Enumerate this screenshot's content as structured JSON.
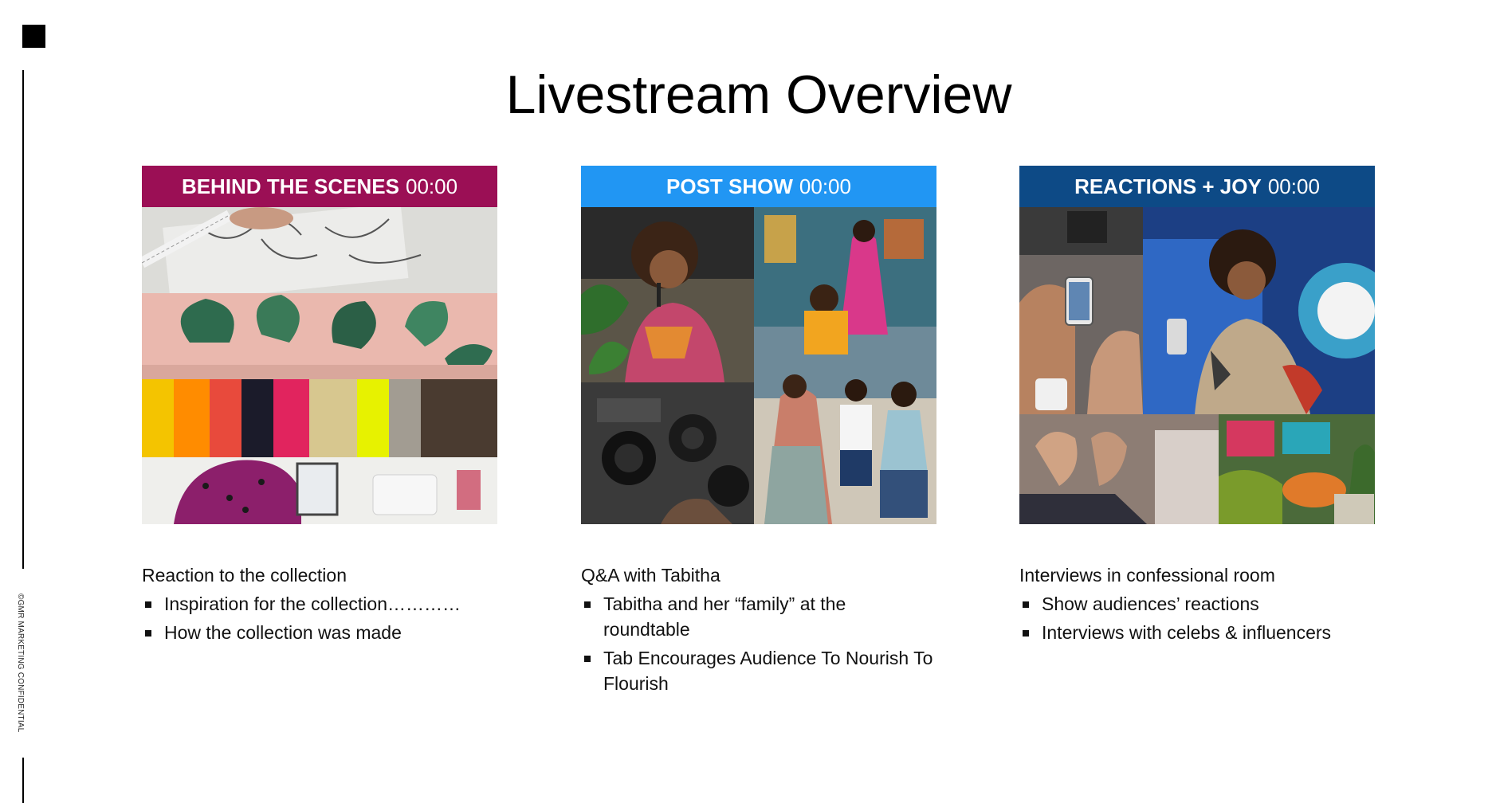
{
  "page": {
    "title": "Livestream Overview",
    "confidential_note": "©GMR MARKETING CONFIDENTIAL"
  },
  "panels": [
    {
      "header_bold": "BEHIND THE SCENES",
      "header_time": "00:00",
      "header_color": "#9b0f55",
      "lead": "Reaction to the collection",
      "bullets": [
        "Inspiration for the collection…………",
        "How the collection was made"
      ]
    },
    {
      "header_bold": "POST SHOW",
      "header_time": "00:00",
      "header_color": "#2196f3",
      "lead": "Q&A with Tabitha",
      "bullets": [
        "Tabitha and her “family” at the roundtable",
        "Tab Encourages Audience To Nourish To Flourish"
      ]
    },
    {
      "header_bold": "REACTIONS + JOY",
      "header_time": "00:00",
      "header_color": "#0d4a86",
      "lead": "Interviews in confessional room",
      "bullets": [
        "Show audiences’ reactions",
        "Interviews with celebs & influencers"
      ]
    }
  ]
}
